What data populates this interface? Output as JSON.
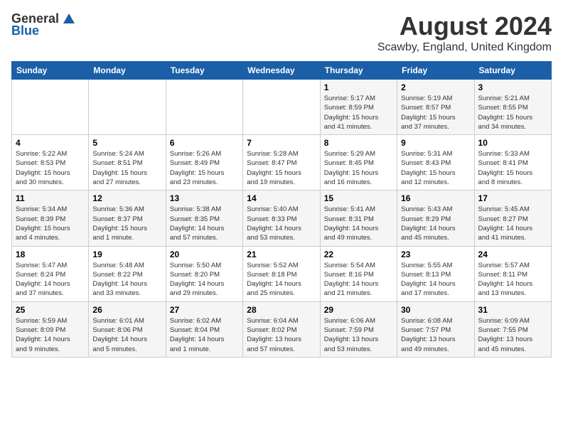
{
  "header": {
    "logo_general": "General",
    "logo_blue": "Blue",
    "month": "August 2024",
    "location": "Scawby, England, United Kingdom"
  },
  "days_of_week": [
    "Sunday",
    "Monday",
    "Tuesday",
    "Wednesday",
    "Thursday",
    "Friday",
    "Saturday"
  ],
  "weeks": [
    [
      {
        "num": "",
        "detail": ""
      },
      {
        "num": "",
        "detail": ""
      },
      {
        "num": "",
        "detail": ""
      },
      {
        "num": "",
        "detail": ""
      },
      {
        "num": "1",
        "detail": "Sunrise: 5:17 AM\nSunset: 8:59 PM\nDaylight: 15 hours\nand 41 minutes."
      },
      {
        "num": "2",
        "detail": "Sunrise: 5:19 AM\nSunset: 8:57 PM\nDaylight: 15 hours\nand 37 minutes."
      },
      {
        "num": "3",
        "detail": "Sunrise: 5:21 AM\nSunset: 8:55 PM\nDaylight: 15 hours\nand 34 minutes."
      }
    ],
    [
      {
        "num": "4",
        "detail": "Sunrise: 5:22 AM\nSunset: 8:53 PM\nDaylight: 15 hours\nand 30 minutes."
      },
      {
        "num": "5",
        "detail": "Sunrise: 5:24 AM\nSunset: 8:51 PM\nDaylight: 15 hours\nand 27 minutes."
      },
      {
        "num": "6",
        "detail": "Sunrise: 5:26 AM\nSunset: 8:49 PM\nDaylight: 15 hours\nand 23 minutes."
      },
      {
        "num": "7",
        "detail": "Sunrise: 5:28 AM\nSunset: 8:47 PM\nDaylight: 15 hours\nand 19 minutes."
      },
      {
        "num": "8",
        "detail": "Sunrise: 5:29 AM\nSunset: 8:45 PM\nDaylight: 15 hours\nand 16 minutes."
      },
      {
        "num": "9",
        "detail": "Sunrise: 5:31 AM\nSunset: 8:43 PM\nDaylight: 15 hours\nand 12 minutes."
      },
      {
        "num": "10",
        "detail": "Sunrise: 5:33 AM\nSunset: 8:41 PM\nDaylight: 15 hours\nand 8 minutes."
      }
    ],
    [
      {
        "num": "11",
        "detail": "Sunrise: 5:34 AM\nSunset: 8:39 PM\nDaylight: 15 hours\nand 4 minutes."
      },
      {
        "num": "12",
        "detail": "Sunrise: 5:36 AM\nSunset: 8:37 PM\nDaylight: 15 hours\nand 1 minute."
      },
      {
        "num": "13",
        "detail": "Sunrise: 5:38 AM\nSunset: 8:35 PM\nDaylight: 14 hours\nand 57 minutes."
      },
      {
        "num": "14",
        "detail": "Sunrise: 5:40 AM\nSunset: 8:33 PM\nDaylight: 14 hours\nand 53 minutes."
      },
      {
        "num": "15",
        "detail": "Sunrise: 5:41 AM\nSunset: 8:31 PM\nDaylight: 14 hours\nand 49 minutes."
      },
      {
        "num": "16",
        "detail": "Sunrise: 5:43 AM\nSunset: 8:29 PM\nDaylight: 14 hours\nand 45 minutes."
      },
      {
        "num": "17",
        "detail": "Sunrise: 5:45 AM\nSunset: 8:27 PM\nDaylight: 14 hours\nand 41 minutes."
      }
    ],
    [
      {
        "num": "18",
        "detail": "Sunrise: 5:47 AM\nSunset: 8:24 PM\nDaylight: 14 hours\nand 37 minutes."
      },
      {
        "num": "19",
        "detail": "Sunrise: 5:48 AM\nSunset: 8:22 PM\nDaylight: 14 hours\nand 33 minutes."
      },
      {
        "num": "20",
        "detail": "Sunrise: 5:50 AM\nSunset: 8:20 PM\nDaylight: 14 hours\nand 29 minutes."
      },
      {
        "num": "21",
        "detail": "Sunrise: 5:52 AM\nSunset: 8:18 PM\nDaylight: 14 hours\nand 25 minutes."
      },
      {
        "num": "22",
        "detail": "Sunrise: 5:54 AM\nSunset: 8:16 PM\nDaylight: 14 hours\nand 21 minutes."
      },
      {
        "num": "23",
        "detail": "Sunrise: 5:55 AM\nSunset: 8:13 PM\nDaylight: 14 hours\nand 17 minutes."
      },
      {
        "num": "24",
        "detail": "Sunrise: 5:57 AM\nSunset: 8:11 PM\nDaylight: 14 hours\nand 13 minutes."
      }
    ],
    [
      {
        "num": "25",
        "detail": "Sunrise: 5:59 AM\nSunset: 8:09 PM\nDaylight: 14 hours\nand 9 minutes."
      },
      {
        "num": "26",
        "detail": "Sunrise: 6:01 AM\nSunset: 8:06 PM\nDaylight: 14 hours\nand 5 minutes."
      },
      {
        "num": "27",
        "detail": "Sunrise: 6:02 AM\nSunset: 8:04 PM\nDaylight: 14 hours\nand 1 minute."
      },
      {
        "num": "28",
        "detail": "Sunrise: 6:04 AM\nSunset: 8:02 PM\nDaylight: 13 hours\nand 57 minutes."
      },
      {
        "num": "29",
        "detail": "Sunrise: 6:06 AM\nSunset: 7:59 PM\nDaylight: 13 hours\nand 53 minutes."
      },
      {
        "num": "30",
        "detail": "Sunrise: 6:08 AM\nSunset: 7:57 PM\nDaylight: 13 hours\nand 49 minutes."
      },
      {
        "num": "31",
        "detail": "Sunrise: 6:09 AM\nSunset: 7:55 PM\nDaylight: 13 hours\nand 45 minutes."
      }
    ]
  ]
}
